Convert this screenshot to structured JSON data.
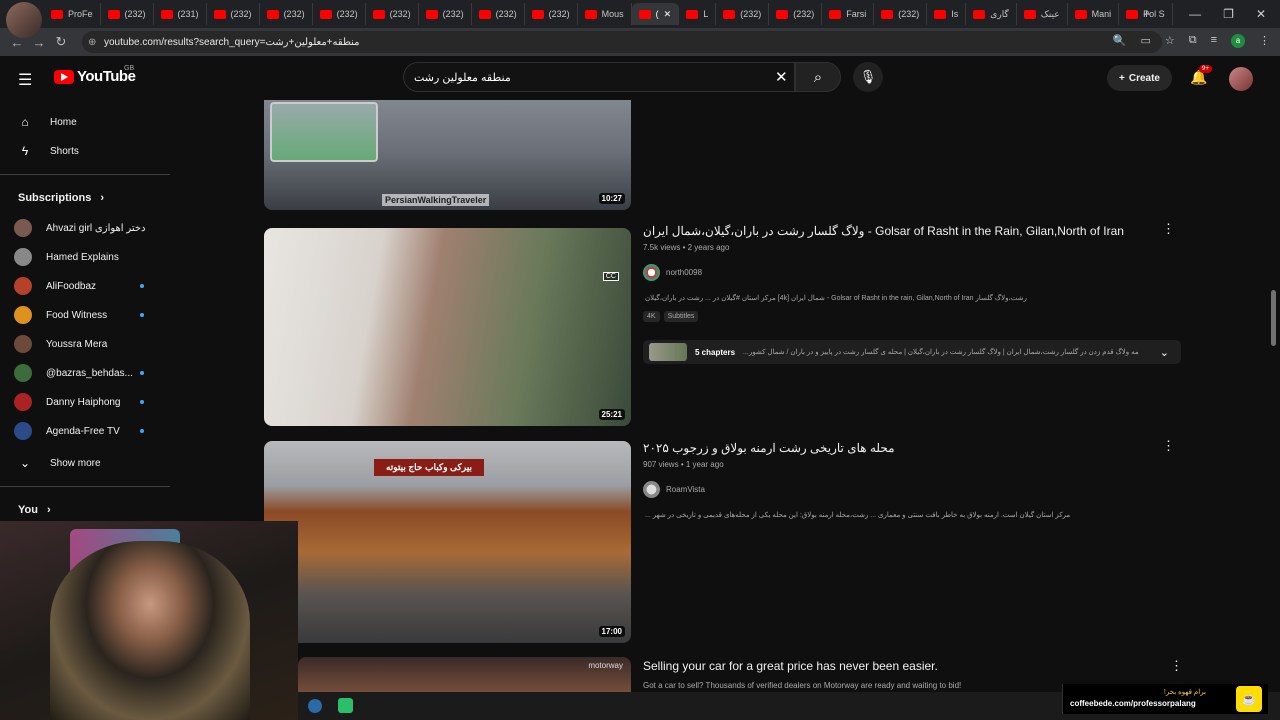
{
  "browser": {
    "tabs": [
      {
        "label": "ProFe",
        "active": false
      },
      {
        "label": "(232)",
        "active": false
      },
      {
        "label": "(231)",
        "active": false
      },
      {
        "label": "(232)",
        "active": false
      },
      {
        "label": "(232)",
        "active": false
      },
      {
        "label": "(232)",
        "active": false
      },
      {
        "label": "(232)",
        "active": false
      },
      {
        "label": "(232)",
        "active": false
      },
      {
        "label": "(232)",
        "active": false
      },
      {
        "label": "(232)",
        "active": false
      },
      {
        "label": "Mous",
        "active": false
      },
      {
        "label": "(",
        "active": true
      },
      {
        "label": "L",
        "active": false
      },
      {
        "label": "(232)",
        "active": false
      },
      {
        "label": "(232)",
        "active": false
      },
      {
        "label": "Farsi",
        "active": false
      },
      {
        "label": "(232)",
        "active": false
      },
      {
        "label": "Is",
        "active": false
      },
      {
        "label": "گاری",
        "active": false
      },
      {
        "label": "عینک",
        "active": false
      },
      {
        "label": "Mani",
        "active": false
      },
      {
        "label": "Pol S",
        "active": false
      }
    ],
    "url": "youtube.com/results?search_query=منطقه+معلولین+رشت",
    "profile_initial": "a"
  },
  "header": {
    "logo_text": "YouTube",
    "region": "GB",
    "search_value": "منطقه معلولین رشت",
    "create_label": "Create",
    "notifications_badge": "9+"
  },
  "sidebar": {
    "home": "Home",
    "shorts": "Shorts",
    "subscriptions_heading": "Subscriptions",
    "subscriptions": [
      {
        "name": "Ahvazi girl دختر اهوازی",
        "dot": false,
        "color": "#7a5a50"
      },
      {
        "name": "Hamed Explains",
        "dot": false,
        "color": "#888"
      },
      {
        "name": "AliFoodbaz",
        "dot": true,
        "color": "#b5412b"
      },
      {
        "name": "Food Witness",
        "dot": true,
        "color": "#e0901f"
      },
      {
        "name": "Youssra Mera",
        "dot": false,
        "color": "#6b4a3a"
      },
      {
        "name": "@bazras_behdas...",
        "dot": true,
        "color": "#3c6b3c"
      },
      {
        "name": "Danny Haiphong",
        "dot": true,
        "color": "#aa2222"
      },
      {
        "name": "Agenda-Free TV",
        "dot": true,
        "color": "#2b4a8a"
      }
    ],
    "show_more": "Show more",
    "you_heading": "You"
  },
  "results": [
    {
      "duration": "10:27",
      "thumb_caption": "PersianWalkingTraveler"
    },
    {
      "title": "ولاگ گلسار رشت در باران،گیلان،شمال ایران - Golsar of Rasht in the Rain, Gilan,North of Iran",
      "views": "7.5k views",
      "age": "2 years ago",
      "channel": "north0098",
      "description": "مرکز استان #گیلان در ... رشت در باران،گیلان [4k] شمال ایران - Golsar of Rasht in the rain, Gilan,North of Iran رشت،ولاگ گلسار",
      "tags": [
        "4K",
        "Subtitles"
      ],
      "chapters_label": "5 chapters",
      "chapters_text": "...مه ولاگ قدم زدن در گلسار رشت،شمال ایران | ولاگ گلسار رشت در باران،گیلان | محله ی گلسار رشت در پاییز و در باران / شمال کشور",
      "duration": "25:21",
      "cc_badge": "CC"
    },
    {
      "title": "محله های تاریخی رشت ارمنه بولاق و زرجوب ۲۰۲۵",
      "views": "907 views",
      "age": "1 year ago",
      "channel": "RoamVista",
      "description": "... مرکز استان گیلان است. ارمنه بولاق به خاطر بافت سنتی و معماری ... رشت،محله ارمنه بولاق: این محله یکی از محله‌های قدیمی و تاریخی در شهر",
      "duration": "17:00",
      "thumb_sign": "بیرکی وکباب حاج بیتوته"
    },
    {
      "title": "Selling your car for a great price has never been easier.",
      "description": "Got a car to sell? Thousands of verified dealers on Motorway are ready and waiting to bid!",
      "thumb_brand": "motorway"
    }
  ],
  "overlay": {
    "coffee_title": "برام قهوه بخر!",
    "coffee_url": "coffeebede.com/professorpalang"
  },
  "colors": {
    "yt_red": "#ff0000",
    "background": "#0f0f0f",
    "link_blue": "#3ea6ff"
  }
}
